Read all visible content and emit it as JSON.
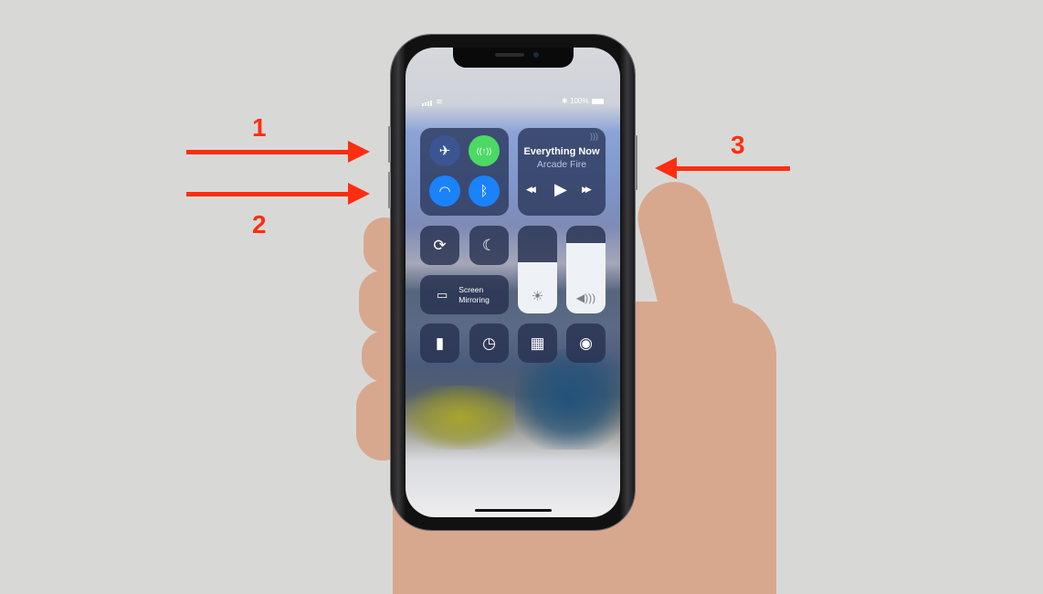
{
  "annotations": {
    "labels": [
      "1",
      "2",
      "3"
    ],
    "arrow_color": "#fe2e10"
  },
  "status_bar": {
    "battery_text": "100%",
    "bluetooth_glyph": "✱"
  },
  "control_center": {
    "connectivity": {
      "airplane_icon": "✈",
      "cellular_icon": "((↑))",
      "wifi_icon": "◠",
      "bluetooth_icon": "ᛒ",
      "cellular_color": "#4cd964",
      "active_color": "#1a82fb"
    },
    "now_playing": {
      "title": "Everything Now",
      "artist": "Arcade Fire",
      "prev_icon": "◀◀",
      "play_icon": "▶",
      "next_icon": "▶▶"
    },
    "toggles": {
      "rotation_lock_icon": "⟳",
      "do_not_disturb_icon": "☾"
    },
    "screen_mirroring": {
      "line1": "Screen",
      "line2": "Mirroring"
    },
    "brightness": {
      "level": 0.58,
      "icon": "☀"
    },
    "volume": {
      "level": 0.8,
      "icon": "🔊"
    },
    "shortcuts": {
      "flashlight_icon": "▮",
      "timer_icon": "◷",
      "calculator_icon": "▦",
      "camera_icon": "◉"
    }
  }
}
